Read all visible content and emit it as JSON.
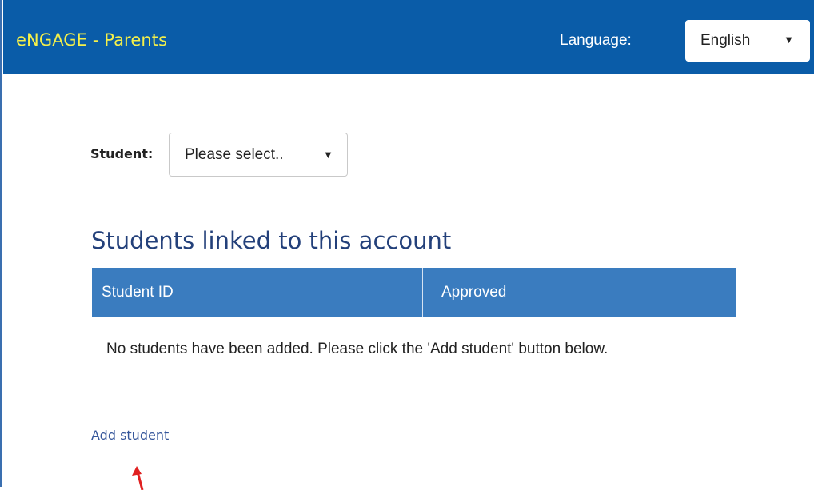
{
  "header": {
    "brand": "eNGAGE - Parents",
    "language_label": "Language:",
    "language_selected": "English",
    "caret": "▼"
  },
  "student_picker": {
    "label": "Student:",
    "selected": "Please select..",
    "caret": "▼"
  },
  "linked_students": {
    "heading": "Students linked to this account",
    "columns": [
      "Student ID",
      "Approved"
    ],
    "empty_message": "No students have been added. Please click the 'Add student' button below."
  },
  "actions": {
    "add_student": "Add student"
  },
  "colors": {
    "header_bg": "#0a5ca8",
    "brand_text": "#f5f04a",
    "table_header_bg": "#3a7cbf",
    "heading_text": "#23407a",
    "link_text": "#34559a",
    "annotation_arrow": "#e02020"
  }
}
